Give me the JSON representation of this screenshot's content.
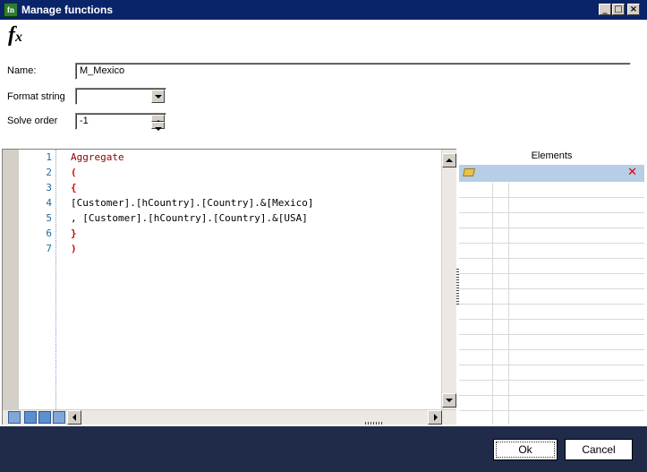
{
  "window": {
    "title": "Manage functions",
    "icon_glyph": "fn"
  },
  "form": {
    "name_label": "Name:",
    "name_value": "M_Mexico",
    "format_label": "Format string",
    "format_value": "",
    "solve_label": "Solve order",
    "solve_value": "-1"
  },
  "editor": {
    "line_numbers": [
      "1",
      "2",
      "3",
      "4",
      "5",
      "6",
      "7"
    ],
    "lines": [
      "Aggregate",
      "(",
      "{",
      "[Customer].[hCountry].[Country].&[Mexico]",
      ", [Customer].[hCountry].[Country].&[USA]",
      "}",
      ")"
    ]
  },
  "elements": {
    "header": "Elements",
    "delete_glyph": "✕"
  },
  "buttons": {
    "ok": "Ok",
    "cancel": "Cancel"
  },
  "colors": {
    "titlebar": "#0a246a",
    "footer": "#1f2b48",
    "keyword": "#8b0000",
    "bracket": "#e00000",
    "line_number": "#1a6b9a"
  }
}
